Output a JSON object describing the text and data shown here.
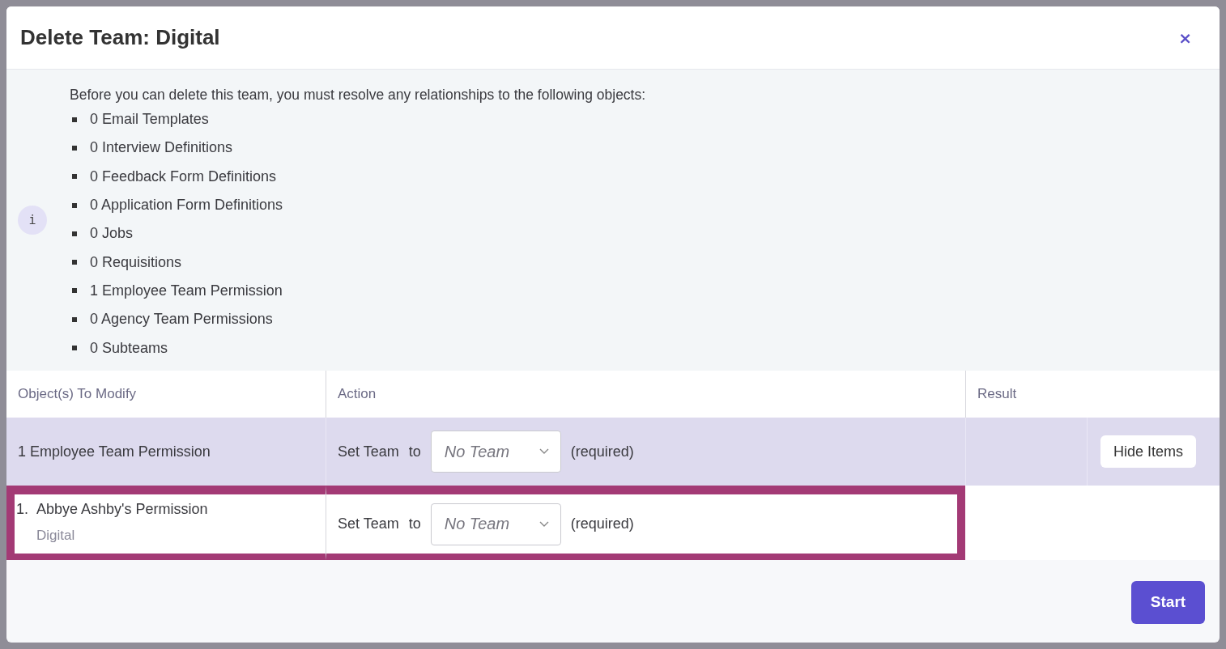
{
  "dialog": {
    "title": "Delete Team: Digital",
    "close": "×"
  },
  "notice": {
    "icon": "i",
    "text": "Before you can delete this team, you must resolve any relationships to the following objects:",
    "items": [
      "0 Email Templates",
      "0 Interview Definitions",
      "0 Feedback Form Definitions",
      "0 Application Form Definitions",
      "0 Jobs",
      "0 Requisitions",
      "1 Employee Team Permission",
      "0 Agency Team Permissions",
      "0 Subteams"
    ]
  },
  "table": {
    "columns": [
      "Object(s) To Modify",
      "Action",
      "Result"
    ],
    "groups": [
      {
        "label": "1 Employee Team Permission",
        "action_label": "Set Team",
        "to": "to",
        "select": {
          "placeholder": "No Team"
        },
        "required": "(required)",
        "button": "Hide Items",
        "items": [
          {
            "number": "1.",
            "name": "Abbye Ashby's Permission",
            "team": "Digital",
            "action_label": "Set Team",
            "to": "to",
            "select": {
              "placeholder": "No Team"
            },
            "required": "(required)",
            "highlighted": true
          }
        ]
      }
    ]
  },
  "footer": {
    "button": "Start"
  }
}
